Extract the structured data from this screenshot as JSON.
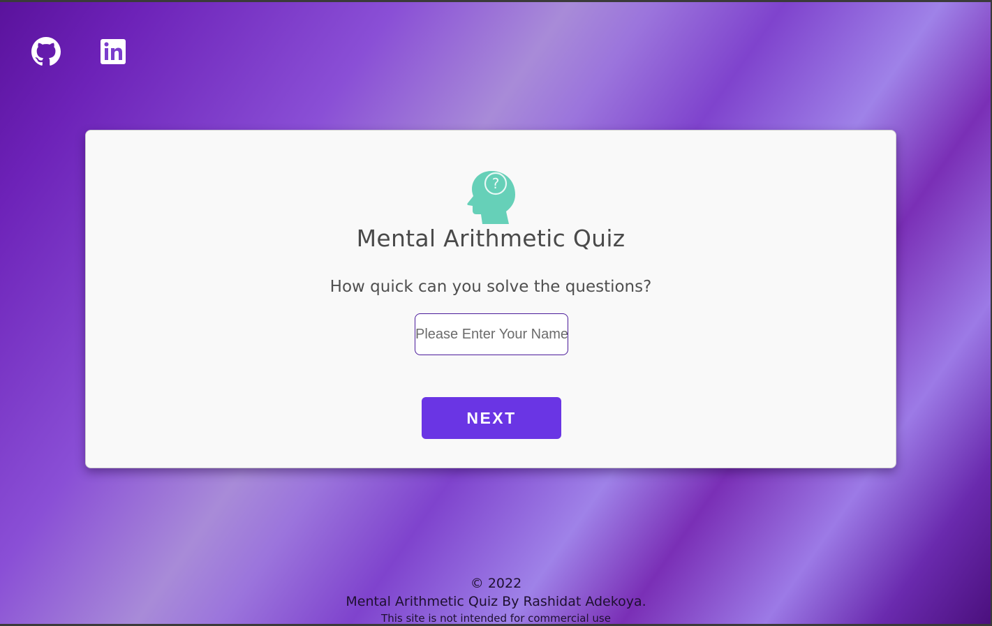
{
  "nav": {
    "github_icon": "github-icon",
    "linkedin_icon": "linkedin-icon"
  },
  "card": {
    "logo_icon": "head-question-icon",
    "title": "Mental Arithmetic Quiz",
    "subtitle": "How quick can you solve the questions?",
    "name_placeholder": "Please Enter Your Name",
    "name_value": "",
    "next_label": "NEXT"
  },
  "footer": {
    "copyright": "© 2022",
    "byline": "Mental Arithmetic Quiz By Rashidat Adekoya.",
    "disclaimer": "This site is not intended for commercial use"
  },
  "colors": {
    "primary_button": "#6a35e4",
    "logo_teal": "#66d0b8",
    "background_purple": "#7f43cd",
    "card_background": "#f9f9f9"
  }
}
